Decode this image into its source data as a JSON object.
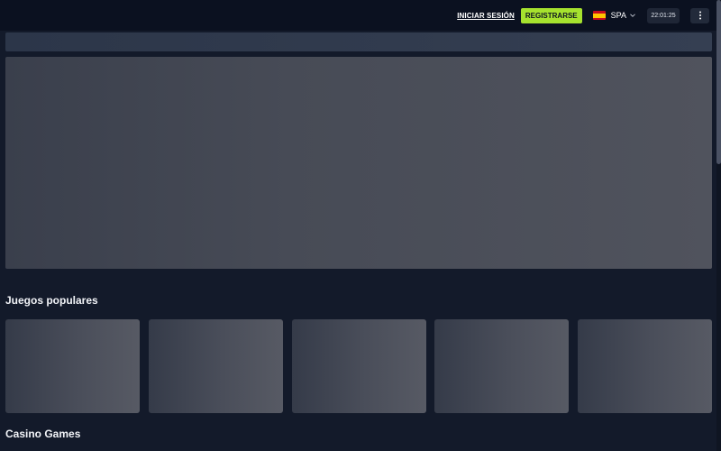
{
  "header": {
    "login_label": "INICIAR SESIÓN",
    "register_label": "REGISTRARSE",
    "language": {
      "flag_icon": "spain-flag-icon",
      "label": "SPA",
      "chevron_icon": "chevron-down-icon"
    },
    "clock": "22:01:25",
    "menu_icon": "more-vertical-icon"
  },
  "sections": {
    "popular": {
      "title": "Juegos populares",
      "cards": 5
    },
    "casino": {
      "title": "Casino Games"
    }
  },
  "colors": {
    "accent": "#a6e22e",
    "background": "#131a2a",
    "header": "#0b1120"
  }
}
